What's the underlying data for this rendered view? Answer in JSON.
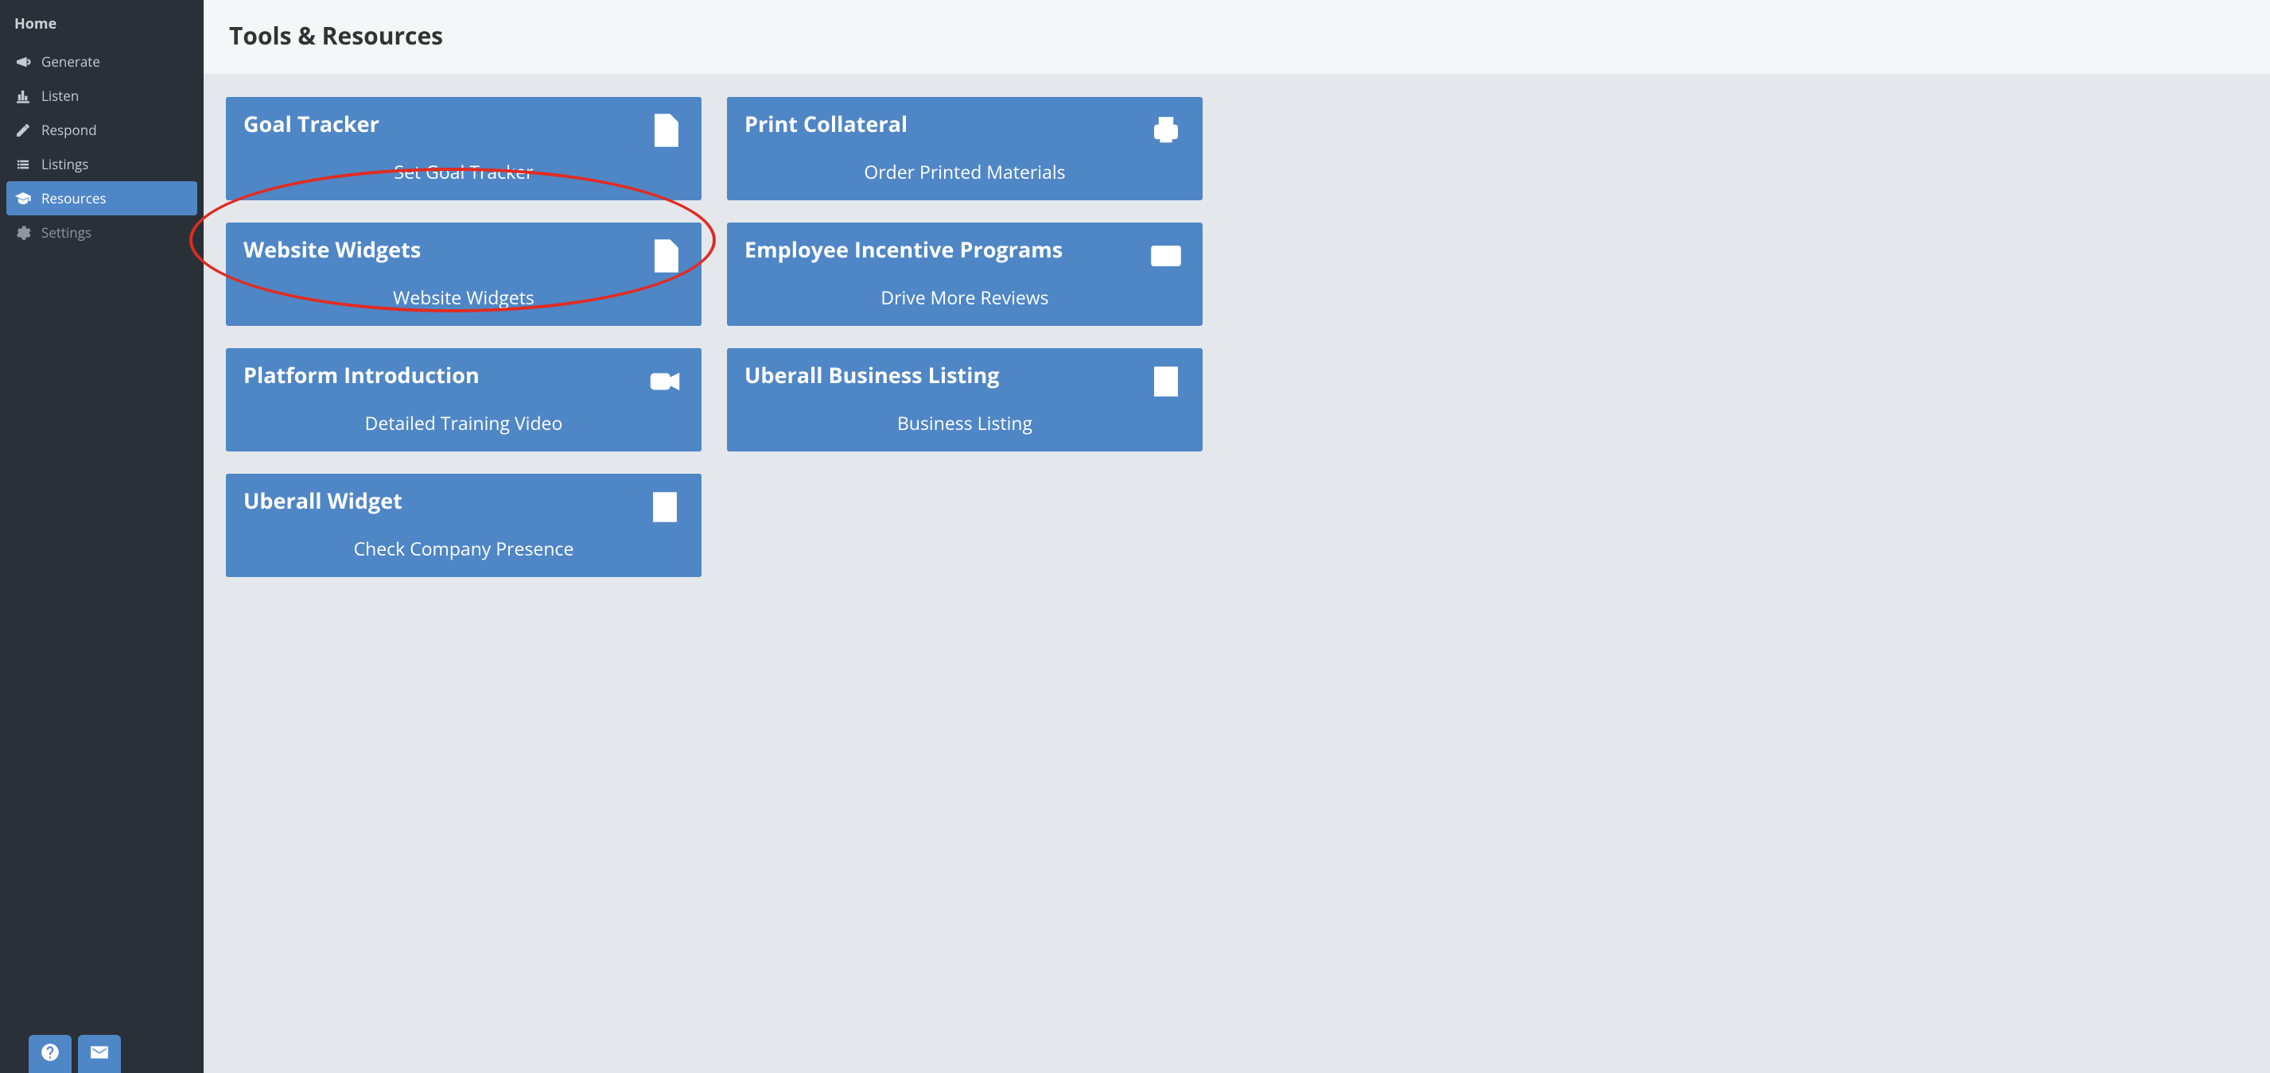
{
  "sidebar": {
    "home_label": "Home",
    "items": [
      {
        "id": "generate",
        "label": "Generate",
        "icon": "megaphone-icon",
        "active": false
      },
      {
        "id": "listen",
        "label": "Listen",
        "icon": "bar-chart-icon",
        "active": false
      },
      {
        "id": "respond",
        "label": "Respond",
        "icon": "edit-icon",
        "active": false
      },
      {
        "id": "listings",
        "label": "Listings",
        "icon": "list-icon",
        "active": false
      },
      {
        "id": "resources",
        "label": "Resources",
        "icon": "graduation-icon",
        "active": true
      },
      {
        "id": "settings",
        "label": "Settings",
        "icon": "gear-icon",
        "active": false,
        "dim": true
      }
    ],
    "bottom_buttons": [
      {
        "id": "help",
        "icon": "help-icon"
      },
      {
        "id": "mail",
        "icon": "envelope-icon"
      }
    ]
  },
  "header": {
    "title": "Tools & Resources"
  },
  "cards": [
    {
      "title": "Goal Tracker",
      "subtitle": "Set Goal Tracker",
      "icon": "image-file-icon"
    },
    {
      "title": "Print Collateral",
      "subtitle": "Order Printed Materials",
      "icon": "printer-icon"
    },
    {
      "title": "Website Widgets",
      "subtitle": "Website Widgets",
      "icon": "code-file-icon",
      "annotated": true
    },
    {
      "title": "Employee Incentive Programs",
      "subtitle": "Drive More Reviews",
      "icon": "credit-card-icon"
    },
    {
      "title": "Platform Introduction",
      "subtitle": "Detailed Training Video",
      "icon": "video-camera-icon"
    },
    {
      "title": "Uberall Business Listing",
      "subtitle": "Business Listing",
      "icon": "building-icon"
    },
    {
      "title": "Uberall Widget",
      "subtitle": "Check Company Presence",
      "icon": "building-icon"
    }
  ],
  "colors": {
    "sidebar_bg": "#2a3038",
    "accent": "#4f86c6",
    "annotation": "#e22b20"
  },
  "annotation": {
    "comment": "Hand-drawn red ellipse highlighting the Website Widgets card"
  }
}
